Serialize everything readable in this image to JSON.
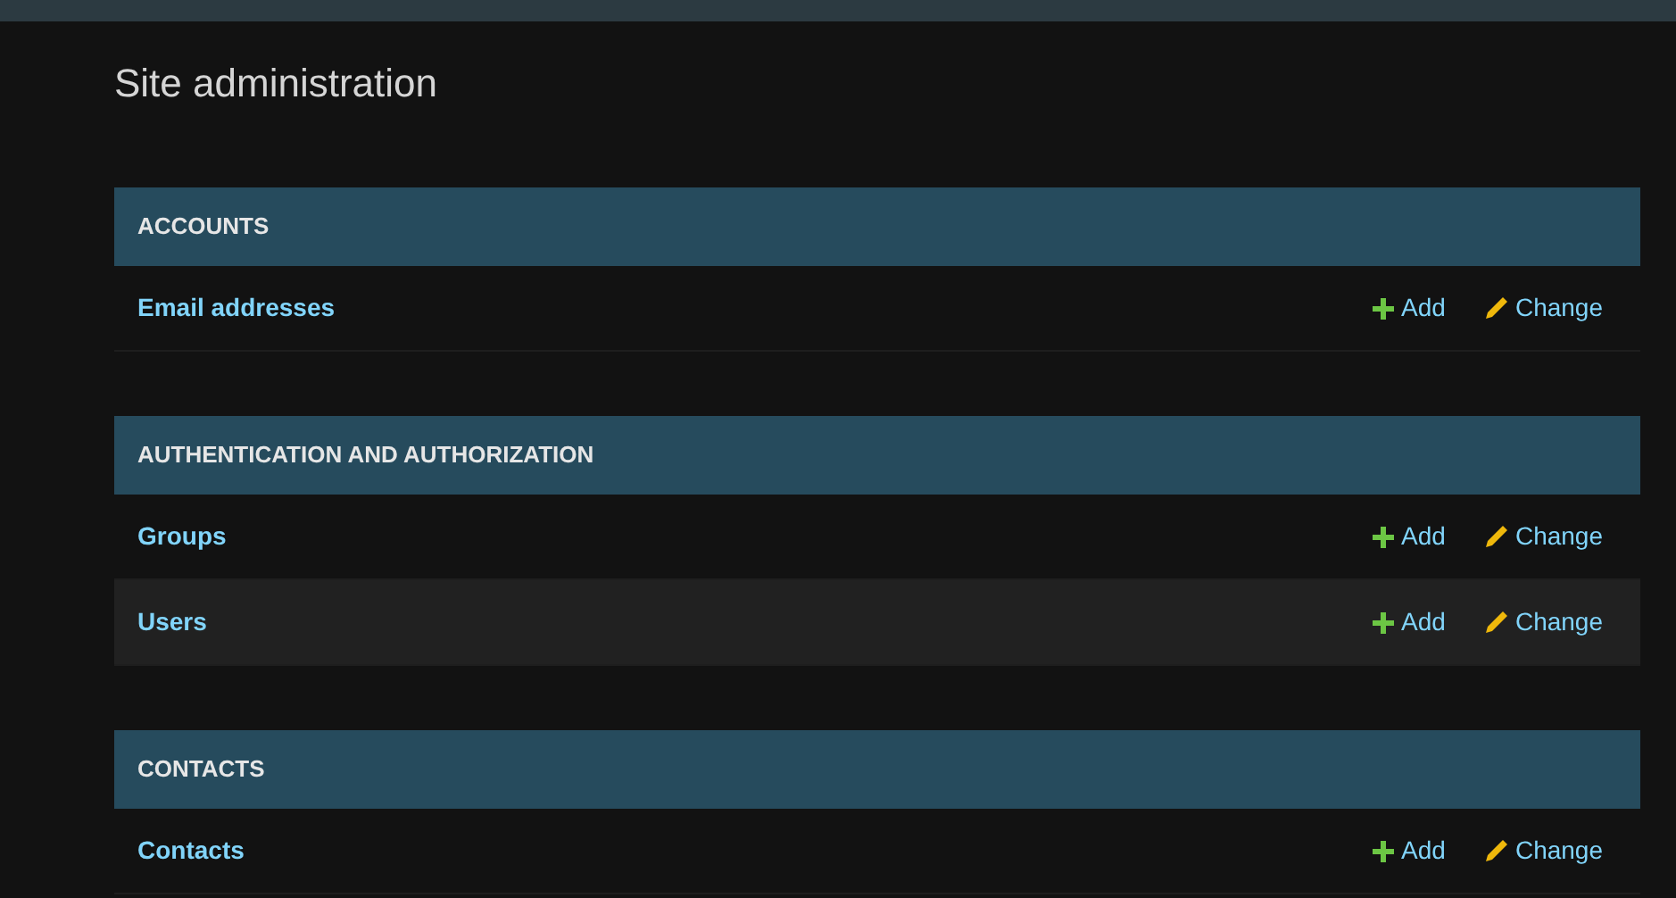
{
  "title": "Site administration",
  "modules": [
    {
      "caption": "ACCOUNTS",
      "models": [
        {
          "name": "Email addresses",
          "add": "Add",
          "change": "Change"
        }
      ]
    },
    {
      "caption": "AUTHENTICATION AND AUTHORIZATION",
      "models": [
        {
          "name": "Groups",
          "add": "Add",
          "change": "Change"
        },
        {
          "name": "Users",
          "add": "Add",
          "change": "Change"
        }
      ]
    },
    {
      "caption": "CONTACTS",
      "models": [
        {
          "name": "Contacts",
          "add": "Add",
          "change": "Change"
        }
      ]
    }
  ]
}
